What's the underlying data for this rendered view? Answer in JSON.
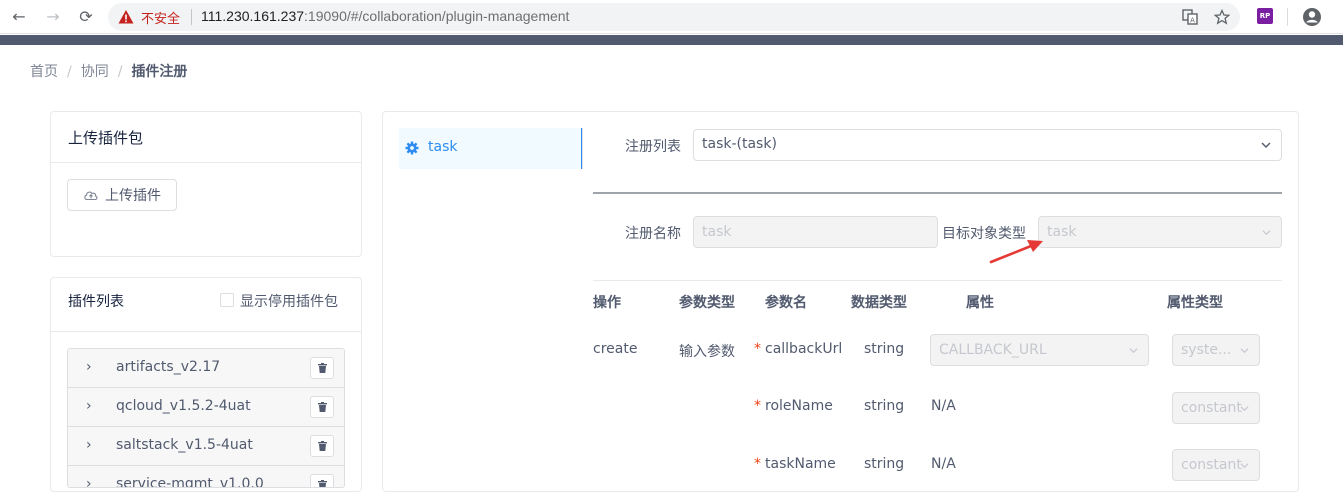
{
  "browser": {
    "back_label": "←",
    "forward_label": "→",
    "reload_label": "⟳",
    "insecure_label": "不安全",
    "url_host": "111.230.161.237",
    "url_rest": ":19090/#/collaboration/plugin-management",
    "extension_label": "RP"
  },
  "breadcrumb": {
    "items": [
      "首页",
      "协同",
      "插件注册"
    ],
    "separator": "/"
  },
  "upload_card": {
    "title": "上传插件包",
    "upload_button": "上传插件"
  },
  "plugin_card": {
    "title": "插件列表",
    "show_disabled_label": "显示停用插件包",
    "plugins": [
      {
        "name": "artifacts_v2.17"
      },
      {
        "name": "qcloud_v1.5.2-4uat"
      },
      {
        "name": "saltstack_v1.5-4uat"
      },
      {
        "name": "service-mgmt_v1.0.0"
      }
    ],
    "expand_glyph": "›"
  },
  "side_menu": {
    "items": [
      {
        "label": "task",
        "active": true
      }
    ]
  },
  "form": {
    "register_list_label": "注册列表",
    "register_list_value": "task-(task)",
    "register_name_label": "注册名称",
    "register_name_value": "task",
    "target_type_label": "目标对象类型",
    "target_type_value": "task"
  },
  "table": {
    "headers": [
      "操作",
      "参数类型",
      "参数名",
      "数据类型",
      "属性",
      "属性类型"
    ],
    "rows": [
      {
        "operation": "create",
        "param_type": "输入参数",
        "required": "*",
        "param_name": "callbackUrl",
        "data_type": "string",
        "attr": "CALLBACK_URL",
        "attr_type": "syste..."
      },
      {
        "operation": "",
        "param_type": "",
        "required": "*",
        "param_name": "roleName",
        "data_type": "string",
        "attr": "N/A",
        "attr_type": "constant"
      },
      {
        "operation": "",
        "param_type": "",
        "required": "*",
        "param_name": "taskName",
        "data_type": "string",
        "attr": "N/A",
        "attr_type": "constant"
      }
    ]
  },
  "colors": {
    "accent": "#2d8cf0",
    "insecure": "#c5221f",
    "required": "#ed4014",
    "annotation_arrow": "#e53935"
  }
}
